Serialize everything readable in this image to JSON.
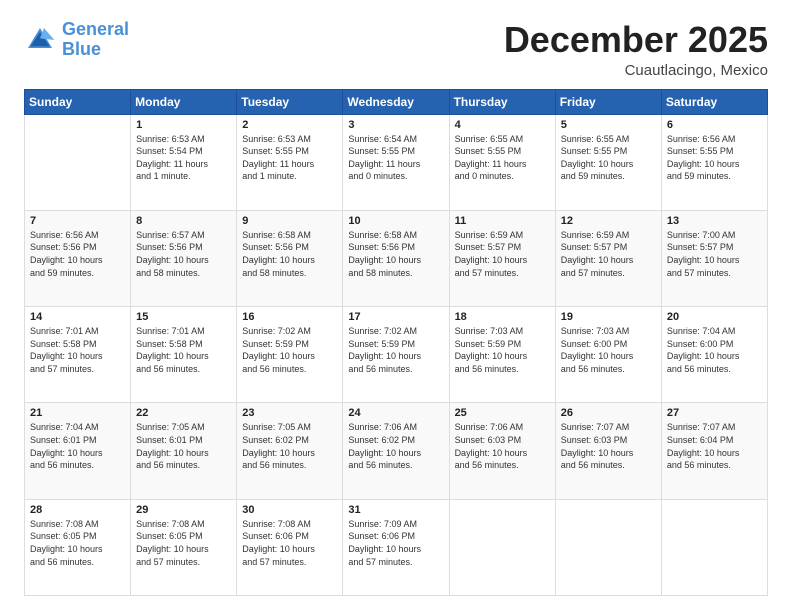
{
  "logo": {
    "line1": "General",
    "line2": "Blue"
  },
  "title": "December 2025",
  "subtitle": "Cuautlacingo, Mexico",
  "days_of_week": [
    "Sunday",
    "Monday",
    "Tuesday",
    "Wednesday",
    "Thursday",
    "Friday",
    "Saturday"
  ],
  "weeks": [
    [
      {
        "day": "",
        "info": ""
      },
      {
        "day": "1",
        "info": "Sunrise: 6:53 AM\nSunset: 5:54 PM\nDaylight: 11 hours\nand 1 minute."
      },
      {
        "day": "2",
        "info": "Sunrise: 6:53 AM\nSunset: 5:55 PM\nDaylight: 11 hours\nand 1 minute."
      },
      {
        "day": "3",
        "info": "Sunrise: 6:54 AM\nSunset: 5:55 PM\nDaylight: 11 hours\nand 0 minutes."
      },
      {
        "day": "4",
        "info": "Sunrise: 6:55 AM\nSunset: 5:55 PM\nDaylight: 11 hours\nand 0 minutes."
      },
      {
        "day": "5",
        "info": "Sunrise: 6:55 AM\nSunset: 5:55 PM\nDaylight: 10 hours\nand 59 minutes."
      },
      {
        "day": "6",
        "info": "Sunrise: 6:56 AM\nSunset: 5:55 PM\nDaylight: 10 hours\nand 59 minutes."
      }
    ],
    [
      {
        "day": "7",
        "info": "Sunrise: 6:56 AM\nSunset: 5:56 PM\nDaylight: 10 hours\nand 59 minutes."
      },
      {
        "day": "8",
        "info": "Sunrise: 6:57 AM\nSunset: 5:56 PM\nDaylight: 10 hours\nand 58 minutes."
      },
      {
        "day": "9",
        "info": "Sunrise: 6:58 AM\nSunset: 5:56 PM\nDaylight: 10 hours\nand 58 minutes."
      },
      {
        "day": "10",
        "info": "Sunrise: 6:58 AM\nSunset: 5:56 PM\nDaylight: 10 hours\nand 58 minutes."
      },
      {
        "day": "11",
        "info": "Sunrise: 6:59 AM\nSunset: 5:57 PM\nDaylight: 10 hours\nand 57 minutes."
      },
      {
        "day": "12",
        "info": "Sunrise: 6:59 AM\nSunset: 5:57 PM\nDaylight: 10 hours\nand 57 minutes."
      },
      {
        "day": "13",
        "info": "Sunrise: 7:00 AM\nSunset: 5:57 PM\nDaylight: 10 hours\nand 57 minutes."
      }
    ],
    [
      {
        "day": "14",
        "info": "Sunrise: 7:01 AM\nSunset: 5:58 PM\nDaylight: 10 hours\nand 57 minutes."
      },
      {
        "day": "15",
        "info": "Sunrise: 7:01 AM\nSunset: 5:58 PM\nDaylight: 10 hours\nand 56 minutes."
      },
      {
        "day": "16",
        "info": "Sunrise: 7:02 AM\nSunset: 5:59 PM\nDaylight: 10 hours\nand 56 minutes."
      },
      {
        "day": "17",
        "info": "Sunrise: 7:02 AM\nSunset: 5:59 PM\nDaylight: 10 hours\nand 56 minutes."
      },
      {
        "day": "18",
        "info": "Sunrise: 7:03 AM\nSunset: 5:59 PM\nDaylight: 10 hours\nand 56 minutes."
      },
      {
        "day": "19",
        "info": "Sunrise: 7:03 AM\nSunset: 6:00 PM\nDaylight: 10 hours\nand 56 minutes."
      },
      {
        "day": "20",
        "info": "Sunrise: 7:04 AM\nSunset: 6:00 PM\nDaylight: 10 hours\nand 56 minutes."
      }
    ],
    [
      {
        "day": "21",
        "info": "Sunrise: 7:04 AM\nSunset: 6:01 PM\nDaylight: 10 hours\nand 56 minutes."
      },
      {
        "day": "22",
        "info": "Sunrise: 7:05 AM\nSunset: 6:01 PM\nDaylight: 10 hours\nand 56 minutes."
      },
      {
        "day": "23",
        "info": "Sunrise: 7:05 AM\nSunset: 6:02 PM\nDaylight: 10 hours\nand 56 minutes."
      },
      {
        "day": "24",
        "info": "Sunrise: 7:06 AM\nSunset: 6:02 PM\nDaylight: 10 hours\nand 56 minutes."
      },
      {
        "day": "25",
        "info": "Sunrise: 7:06 AM\nSunset: 6:03 PM\nDaylight: 10 hours\nand 56 minutes."
      },
      {
        "day": "26",
        "info": "Sunrise: 7:07 AM\nSunset: 6:03 PM\nDaylight: 10 hours\nand 56 minutes."
      },
      {
        "day": "27",
        "info": "Sunrise: 7:07 AM\nSunset: 6:04 PM\nDaylight: 10 hours\nand 56 minutes."
      }
    ],
    [
      {
        "day": "28",
        "info": "Sunrise: 7:08 AM\nSunset: 6:05 PM\nDaylight: 10 hours\nand 56 minutes."
      },
      {
        "day": "29",
        "info": "Sunrise: 7:08 AM\nSunset: 6:05 PM\nDaylight: 10 hours\nand 57 minutes."
      },
      {
        "day": "30",
        "info": "Sunrise: 7:08 AM\nSunset: 6:06 PM\nDaylight: 10 hours\nand 57 minutes."
      },
      {
        "day": "31",
        "info": "Sunrise: 7:09 AM\nSunset: 6:06 PM\nDaylight: 10 hours\nand 57 minutes."
      },
      {
        "day": "",
        "info": ""
      },
      {
        "day": "",
        "info": ""
      },
      {
        "day": "",
        "info": ""
      }
    ]
  ]
}
